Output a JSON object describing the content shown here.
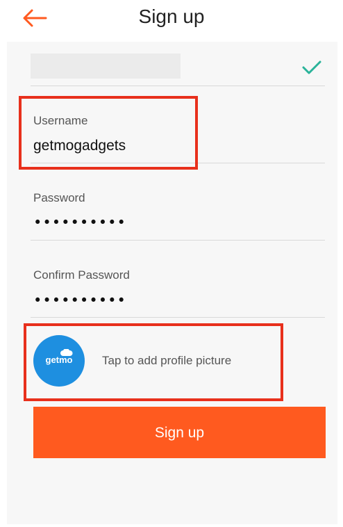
{
  "header": {
    "title": "Sign up"
  },
  "form": {
    "username": {
      "label": "Username",
      "value": "getmogadgets"
    },
    "password": {
      "label": "Password",
      "value": "••••••••••"
    },
    "confirm_password": {
      "label": "Confirm Password",
      "value": "••••••••••"
    },
    "profile_picture": {
      "prompt": "Tap to add profile picture",
      "avatar_text": "getmo"
    },
    "submit_label": "Sign up"
  },
  "colors": {
    "accent": "#ff5a1f",
    "highlight": "#e8301c",
    "check": "#2ab39a",
    "avatar": "#1e8fe0"
  }
}
